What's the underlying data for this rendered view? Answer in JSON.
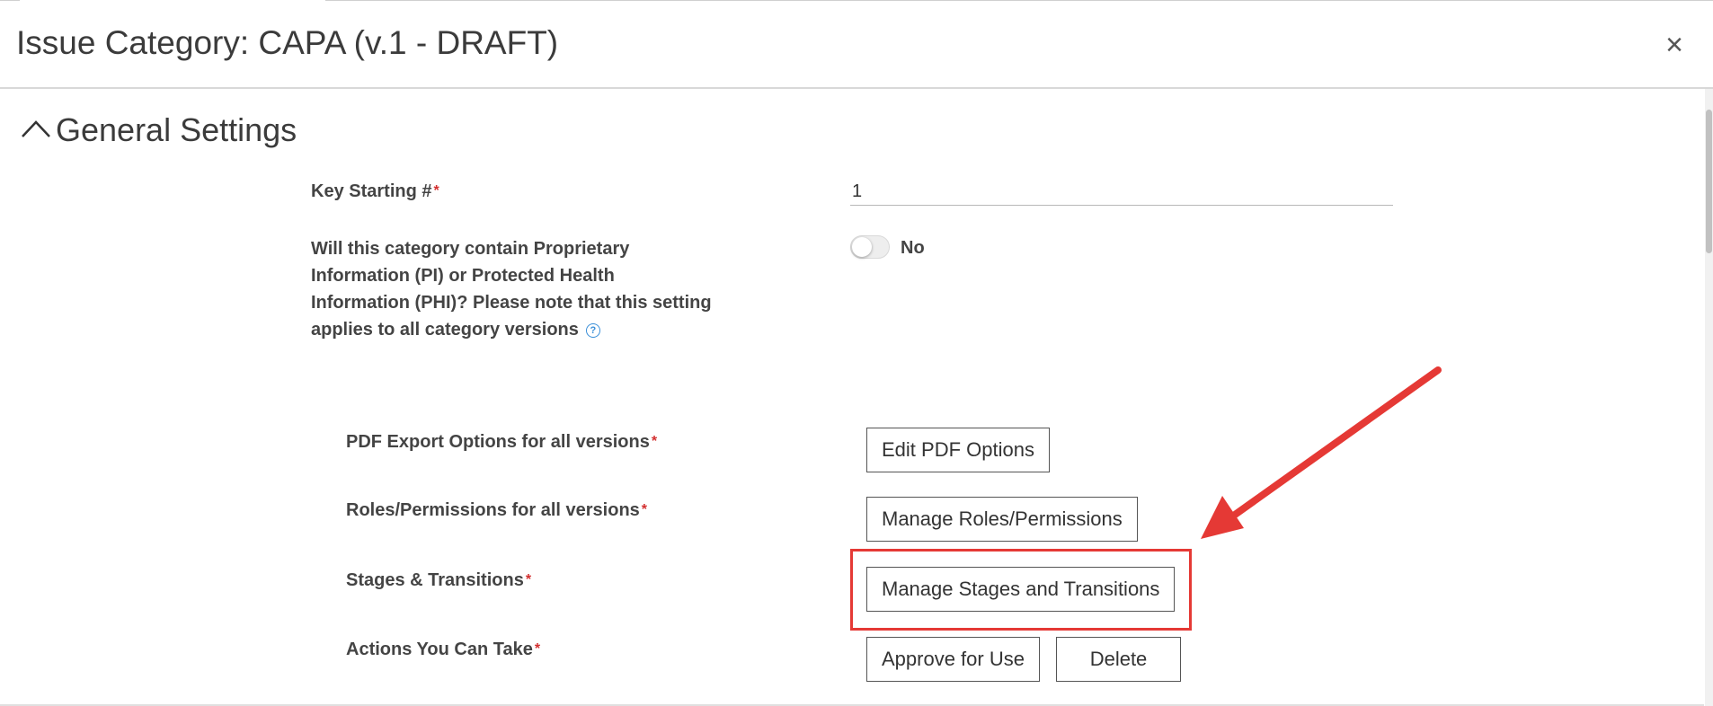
{
  "dialog": {
    "title": "Issue Category: CAPA (v.1 - DRAFT)",
    "close_icon": "×"
  },
  "section": {
    "title": "General Settings",
    "chevron_icon": "chevron-up-icon"
  },
  "form": {
    "key_starting": {
      "label": "Key Starting #",
      "required_mark": "*",
      "value": "1"
    },
    "pi_phi": {
      "label": "Will this category contain Proprietary Information (PI) or Protected Health Information (PHI)? Please note that this setting applies to all category versions",
      "help_icon": "?",
      "toggle_label": "No"
    },
    "pdf_export": {
      "label": "PDF Export Options for all versions",
      "required_mark": "*",
      "button": "Edit PDF Options"
    },
    "roles": {
      "label": "Roles/Permissions for all versions",
      "required_mark": "*",
      "button": "Manage Roles/Permissions"
    },
    "stages": {
      "label": "Stages & Transitions",
      "required_mark": "*",
      "button": "Manage Stages and Transitions"
    },
    "actions": {
      "label": "Actions You Can Take",
      "required_mark": "*",
      "approve_button": "Approve for Use",
      "delete_button": "Delete"
    }
  },
  "annotation": {
    "color": "#e53935"
  }
}
